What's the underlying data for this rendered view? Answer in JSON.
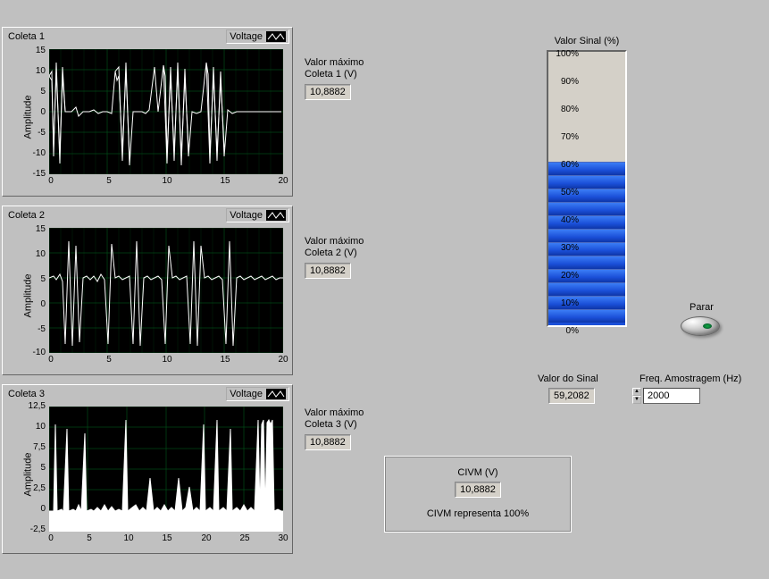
{
  "charts": [
    {
      "title": "Coleta 1",
      "legend": "Voltage",
      "ylabel": "Amplitude",
      "value_label": "Valor máximo\nColeta 1 (V)",
      "value": "10,8882"
    },
    {
      "title": "Coleta 2",
      "legend": "Voltage",
      "ylabel": "Amplitude",
      "value_label": "Valor máximo\nColeta 2 (V)",
      "value": "10,8882"
    },
    {
      "title": "Coleta 3",
      "legend": "Voltage",
      "ylabel": "Amplitude",
      "value_label": "Valor máximo\nColeta 3 (V)",
      "value": "10,8882"
    }
  ],
  "tank": {
    "title": "Valor Sinal (%)",
    "ticks": [
      "100%",
      "90%",
      "80%",
      "70%",
      "60%",
      "50%",
      "40%",
      "30%",
      "20%",
      "10%",
      "0%"
    ],
    "fill_percent": 59
  },
  "parar_label": "Parar",
  "valor_sinal": {
    "label": "Valor do Sinal",
    "value": "59,2082"
  },
  "freq": {
    "label": "Freq. Amostragem (Hz)",
    "value": "2000"
  },
  "civm": {
    "label": "CIVM (V)",
    "value": "10,8882",
    "note": "CIVM representa 100%"
  },
  "chart_data": [
    {
      "type": "line",
      "title": "Coleta 1",
      "xlabel": "",
      "ylabel": "Amplitude",
      "xlim": [
        0,
        20
      ],
      "ylim": [
        -15,
        15
      ],
      "xticks": [
        0,
        5,
        10,
        15,
        20
      ],
      "yticks": [
        -15,
        -10,
        -5,
        0,
        5,
        10,
        15
      ],
      "series": [
        {
          "name": "Voltage",
          "note": "dense time-series oscillating roughly between -12 and 12 with bursts around x=1-3, 6-9, 10-13, 14-16; quiescent near 0 elsewhere"
        }
      ]
    },
    {
      "type": "line",
      "title": "Coleta 2",
      "xlabel": "",
      "ylabel": "Amplitude",
      "xlim": [
        0,
        20
      ],
      "ylim": [
        -10,
        15
      ],
      "xticks": [
        0,
        5,
        10,
        15,
        20
      ],
      "yticks": [
        -10,
        -5,
        0,
        5,
        10,
        15
      ],
      "series": [
        {
          "name": "Voltage",
          "note": "baseline near 5 with downward bursts to ~ -8 at x≈1-3,5,7-8,10,12-13,15-16"
        }
      ]
    },
    {
      "type": "line",
      "title": "Coleta 3",
      "xlabel": "",
      "ylabel": "Amplitude",
      "xlim": [
        0,
        30
      ],
      "ylim": [
        -2.5,
        12.5
      ],
      "xticks": [
        0,
        5,
        10,
        15,
        20,
        25,
        30
      ],
      "yticks": [
        -2.5,
        0,
        2.5,
        5,
        7.5,
        10,
        12.5
      ],
      "series": [
        {
          "name": "Voltage",
          "note": "mostly near 0-1 with many narrow spikes up to ~10-11 throughout, and a solid burst block near x=27-29"
        }
      ]
    }
  ]
}
